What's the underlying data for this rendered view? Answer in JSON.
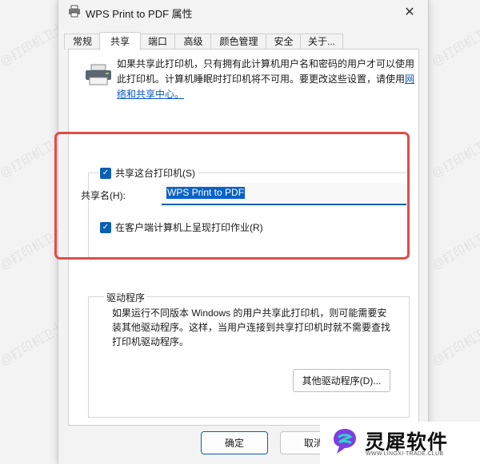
{
  "watermark": "@打印机卫士",
  "window": {
    "title": "WPS Print to PDF 属性",
    "close": "✕"
  },
  "tabs": [
    {
      "label": "常规"
    },
    {
      "label": "共享"
    },
    {
      "label": "端口"
    },
    {
      "label": "高级"
    },
    {
      "label": "颜色管理"
    },
    {
      "label": "安全"
    },
    {
      "label": "关于..."
    }
  ],
  "info": {
    "text": "如果共享此打印机，只有拥有此计算机用户名和密码的用户才可以使用此打印机。计算机睡眠时打印机将不可用。要更改这些设置，请使用",
    "link": "网络和共享中心。"
  },
  "share": {
    "share_checkbox": "共享这台打印机(S)",
    "share_name_label": "共享名(H):",
    "share_name_value": "WPS Print to PDF",
    "render_checkbox": "在客户端计算机上呈现打印作业(R)"
  },
  "drivers": {
    "legend": "驱动程序",
    "text": "如果运行不同版本 Windows 的用户共享此打印机，则可能需要安装其他驱动程序。这样，当用户连接到共享打印机时就不需要查找打印机驱动程序。",
    "button": "其他驱动程序(D)..."
  },
  "buttons": {
    "ok": "确定",
    "cancel": "取消"
  },
  "brand": {
    "name": "灵犀软件",
    "url": "WWW.LINGXI-TRADE.CLUB"
  },
  "colors": {
    "accent": "#0a5fb4",
    "highlight": "#e24b4b"
  }
}
